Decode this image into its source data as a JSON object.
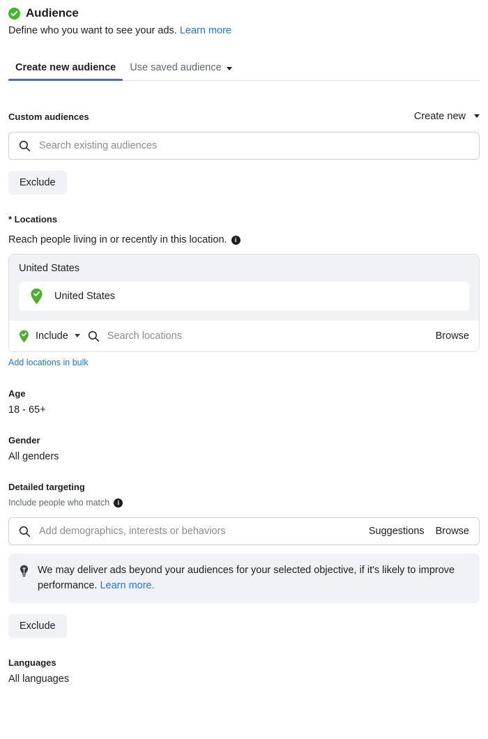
{
  "header": {
    "status_icon": "check-circle-icon",
    "title": "Audience",
    "subtitle": "Define who you want to see your ads.",
    "learn_more": "Learn more"
  },
  "tabs": [
    {
      "label": "Create new audience",
      "active": true,
      "has_caret": false
    },
    {
      "label": "Use saved audience",
      "active": false,
      "has_caret": true
    }
  ],
  "custom_audiences": {
    "label": "Custom audiences",
    "create_new": "Create new",
    "search_placeholder": "Search existing audiences",
    "search_value": "",
    "search_icon": "search-icon",
    "exclude_button": "Exclude"
  },
  "locations": {
    "label": "* Locations",
    "description": "Reach people living in or recently in this location.",
    "info_icon": "info-icon",
    "country_header": "United States",
    "selected": [
      {
        "name": "United States",
        "icon": "map-pin-check-icon"
      }
    ],
    "include_label": "Include",
    "search_placeholder": "Search locations",
    "search_value": "",
    "browse_label": "Browse",
    "bulk_link": "Add locations in bulk"
  },
  "age": {
    "label": "Age",
    "value": "18 - 65+"
  },
  "gender": {
    "label": "Gender",
    "value": "All genders"
  },
  "detailed_targeting": {
    "label": "Detailed targeting",
    "sub_label": "Include people who match",
    "info_icon": "info-icon",
    "search_placeholder": "Add demographics, interests or behaviors",
    "search_value": "",
    "suggestions_label": "Suggestions",
    "browse_label": "Browse",
    "tip_icon": "lightbulb-icon",
    "tip_text": "We may deliver ads beyond your audiences for your selected objective, if it's likely to improve performance.",
    "tip_link": "Learn more.",
    "exclude_button": "Exclude"
  },
  "languages": {
    "label": "Languages",
    "value": "All languages"
  },
  "colors": {
    "accent_blue": "#1877f2",
    "tab_underline": "#4a69c4",
    "green": "#42b72a",
    "pin_green": "#4caf2f",
    "grey_bg": "#f0f2f5",
    "border": "#dddfe2",
    "text": "#1c1e21",
    "muted": "#8a8d91"
  }
}
